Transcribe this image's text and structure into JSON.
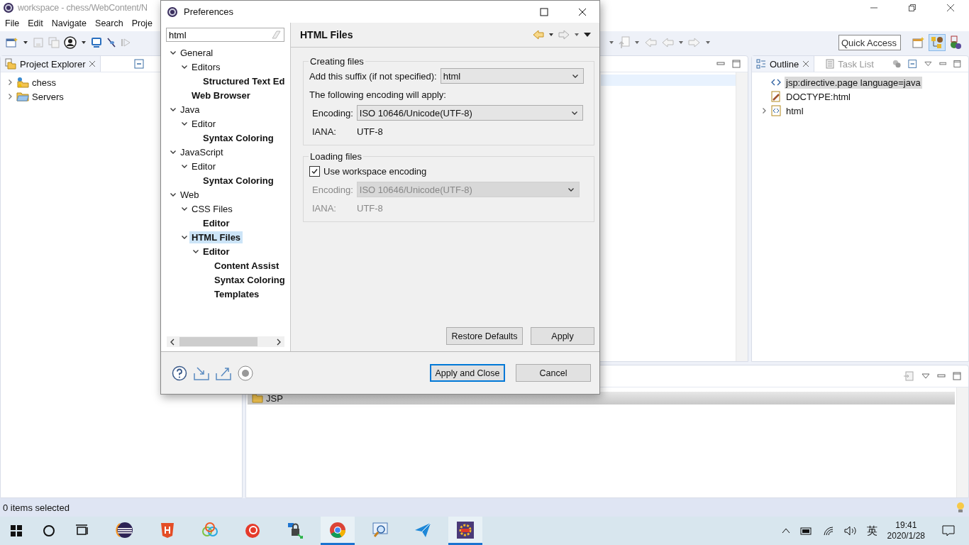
{
  "ide": {
    "title": "workspace - chess/WebContent/N",
    "menu": [
      "File",
      "Edit",
      "Navigate",
      "Search",
      "Proje"
    ],
    "quick_access": {
      "placeholder": "Quick Access"
    },
    "project_explorer": {
      "title": "Project Explorer",
      "items": [
        {
          "label": "chess",
          "kind": "project"
        },
        {
          "label": "Servers",
          "kind": "folder"
        }
      ]
    },
    "outline": {
      "tabs": [
        {
          "label": "Outline",
          "selected": true
        },
        {
          "label": "Task List",
          "selected": false
        }
      ],
      "items": [
        {
          "label": "jsp:directive.page language=java",
          "kind": "directive",
          "selected": true,
          "expandable": false
        },
        {
          "label": "DOCTYPE:html",
          "kind": "doctype",
          "selected": false,
          "expandable": false
        },
        {
          "label": "html",
          "kind": "element",
          "selected": false,
          "expandable": true
        }
      ]
    },
    "bottom_panel": {
      "rows": [
        {
          "label": "JSP"
        }
      ]
    },
    "status_bar": "0 items selected"
  },
  "taskbar": {
    "apps": [
      {
        "kind": "eclipse",
        "running": false
      },
      {
        "kind": "shield",
        "running": false
      },
      {
        "kind": "rings",
        "running": false
      },
      {
        "kind": "swirl",
        "running": false
      },
      {
        "kind": "lock",
        "running": false
      },
      {
        "kind": "browser",
        "running": true
      },
      {
        "kind": "magnifier",
        "running": false
      },
      {
        "kind": "plane",
        "running": false
      },
      {
        "kind": "gear",
        "running": true
      }
    ],
    "ime": "英",
    "time": "19:41",
    "date": "2020/1/28"
  },
  "dialog": {
    "title": "Preferences",
    "filter": {
      "value": "html"
    },
    "tree": [
      {
        "label": "General",
        "expanded": true,
        "matched": false,
        "selected": false,
        "children": [
          {
            "label": "Editors",
            "expanded": true,
            "matched": false,
            "selected": false,
            "children": [
              {
                "label": "Structured Text Ed",
                "matched": true,
                "selected": false
              }
            ]
          },
          {
            "label": "Web Browser",
            "matched": true,
            "selected": false
          }
        ]
      },
      {
        "label": "Java",
        "expanded": true,
        "matched": false,
        "selected": false,
        "children": [
          {
            "label": "Editor",
            "expanded": true,
            "matched": false,
            "selected": false,
            "children": [
              {
                "label": "Syntax Coloring",
                "matched": true,
                "selected": false
              }
            ]
          }
        ]
      },
      {
        "label": "JavaScript",
        "expanded": true,
        "matched": false,
        "selected": false,
        "children": [
          {
            "label": "Editor",
            "expanded": true,
            "matched": false,
            "selected": false,
            "children": [
              {
                "label": "Syntax Coloring",
                "matched": true,
                "selected": false
              }
            ]
          }
        ]
      },
      {
        "label": "Web",
        "expanded": true,
        "matched": false,
        "selected": false,
        "children": [
          {
            "label": "CSS Files",
            "expanded": true,
            "matched": false,
            "selected": false,
            "children": [
              {
                "label": "Editor",
                "matched": true,
                "selected": false
              }
            ]
          },
          {
            "label": "HTML Files",
            "expanded": true,
            "matched": true,
            "selected": true,
            "children": [
              {
                "label": "Editor",
                "expanded": true,
                "matched": true,
                "selected": false,
                "children": [
                  {
                    "label": "Content Assist",
                    "matched": true,
                    "selected": false
                  },
                  {
                    "label": "Syntax Coloring",
                    "matched": true,
                    "selected": false
                  },
                  {
                    "label": "Templates",
                    "matched": true,
                    "selected": false
                  }
                ]
              }
            ]
          }
        ]
      }
    ],
    "page_title": "HTML Files",
    "creating": {
      "title": "Creating files",
      "suffix_label": "Add this suffix (if not specified):",
      "suffix": "html",
      "note": "The following encoding will apply:",
      "encoding_label": "Encoding:",
      "encoding": "ISO 10646/Unicode(UTF-8)",
      "iana_label": "IANA:",
      "iana": "UTF-8"
    },
    "loading": {
      "title": "Loading files",
      "checkbox": {
        "label": "Use workspace encoding",
        "checked": true
      },
      "encoding_label": "Encoding:",
      "encoding": "ISO 10646/Unicode(UTF-8)",
      "iana_label": "IANA:",
      "iana": "UTF-8",
      "disabled": true
    },
    "buttons": [
      {
        "label": "Restore Defaults",
        "default": false
      },
      {
        "label": "Apply",
        "default": false
      }
    ],
    "footer_buttons": [
      {
        "label": "Apply and Close",
        "default": true
      },
      {
        "label": "Cancel",
        "default": false
      }
    ]
  }
}
